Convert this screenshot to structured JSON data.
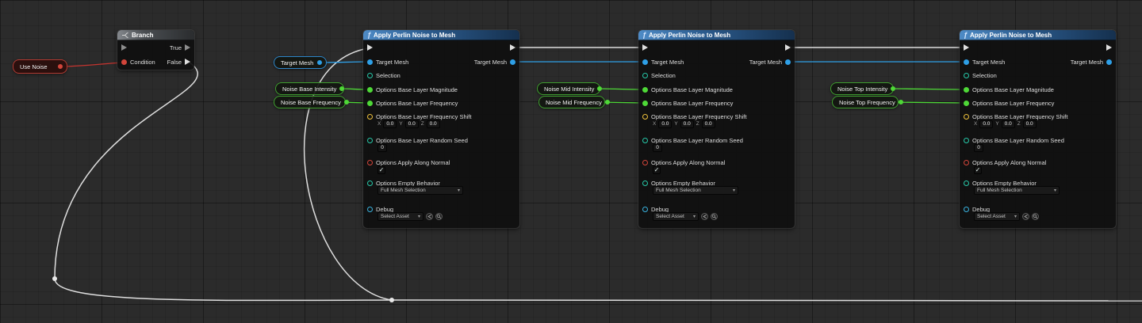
{
  "colors": {
    "background": "#2b2b2b",
    "exec_wire": "#dedede",
    "bool_wire": "#c5342f",
    "object_wire": "#2e9fe6",
    "float_wire": "#4ed837",
    "function_header": "#3a77ad"
  },
  "icons": {
    "function": "ƒ",
    "chevron_down": "▾",
    "check": "✓"
  },
  "variables": {
    "use_noise": {
      "label": "Use Noise"
    },
    "target_mesh": {
      "label": "Target Mesh"
    },
    "noise_base_intensity": {
      "label": "Noise Base Intensity"
    },
    "noise_base_frequency": {
      "label": "Noise Base Frequency"
    },
    "noise_mid_intensity": {
      "label": "Noise Mid Intensity"
    },
    "noise_mid_frequency": {
      "label": "Noise Mid Frequency"
    },
    "noise_top_intensity": {
      "label": "Noise Top Intensity"
    },
    "noise_top_frequency": {
      "label": "Noise Top Frequency"
    }
  },
  "branch": {
    "title": "Branch",
    "condition_label": "Condition",
    "true_label": "True",
    "false_label": "False"
  },
  "perlin": {
    "title": "Apply Perlin Noise to Mesh",
    "pins": {
      "target_mesh_in": "Target Mesh",
      "target_mesh_out": "Target Mesh",
      "selection": "Selection",
      "magnitude": "Options Base Layer Magnitude",
      "frequency": "Options Base Layer Frequency",
      "frequency_shift": "Options Base Layer Frequency Shift",
      "random_seed": "Options Base Layer Random Seed",
      "apply_along_normal": "Options Apply Along Normal",
      "empty_behavior": "Options Empty Behavior",
      "debug": "Debug"
    },
    "fields": {
      "x_label": "X",
      "x_value": "0.0",
      "y_label": "Y",
      "y_value": "0.0",
      "z_label": "Z",
      "z_value": "0.0",
      "random_seed_value": "0",
      "empty_behavior_value": "Full Mesh Selection",
      "debug_value": "Select Asset"
    }
  }
}
